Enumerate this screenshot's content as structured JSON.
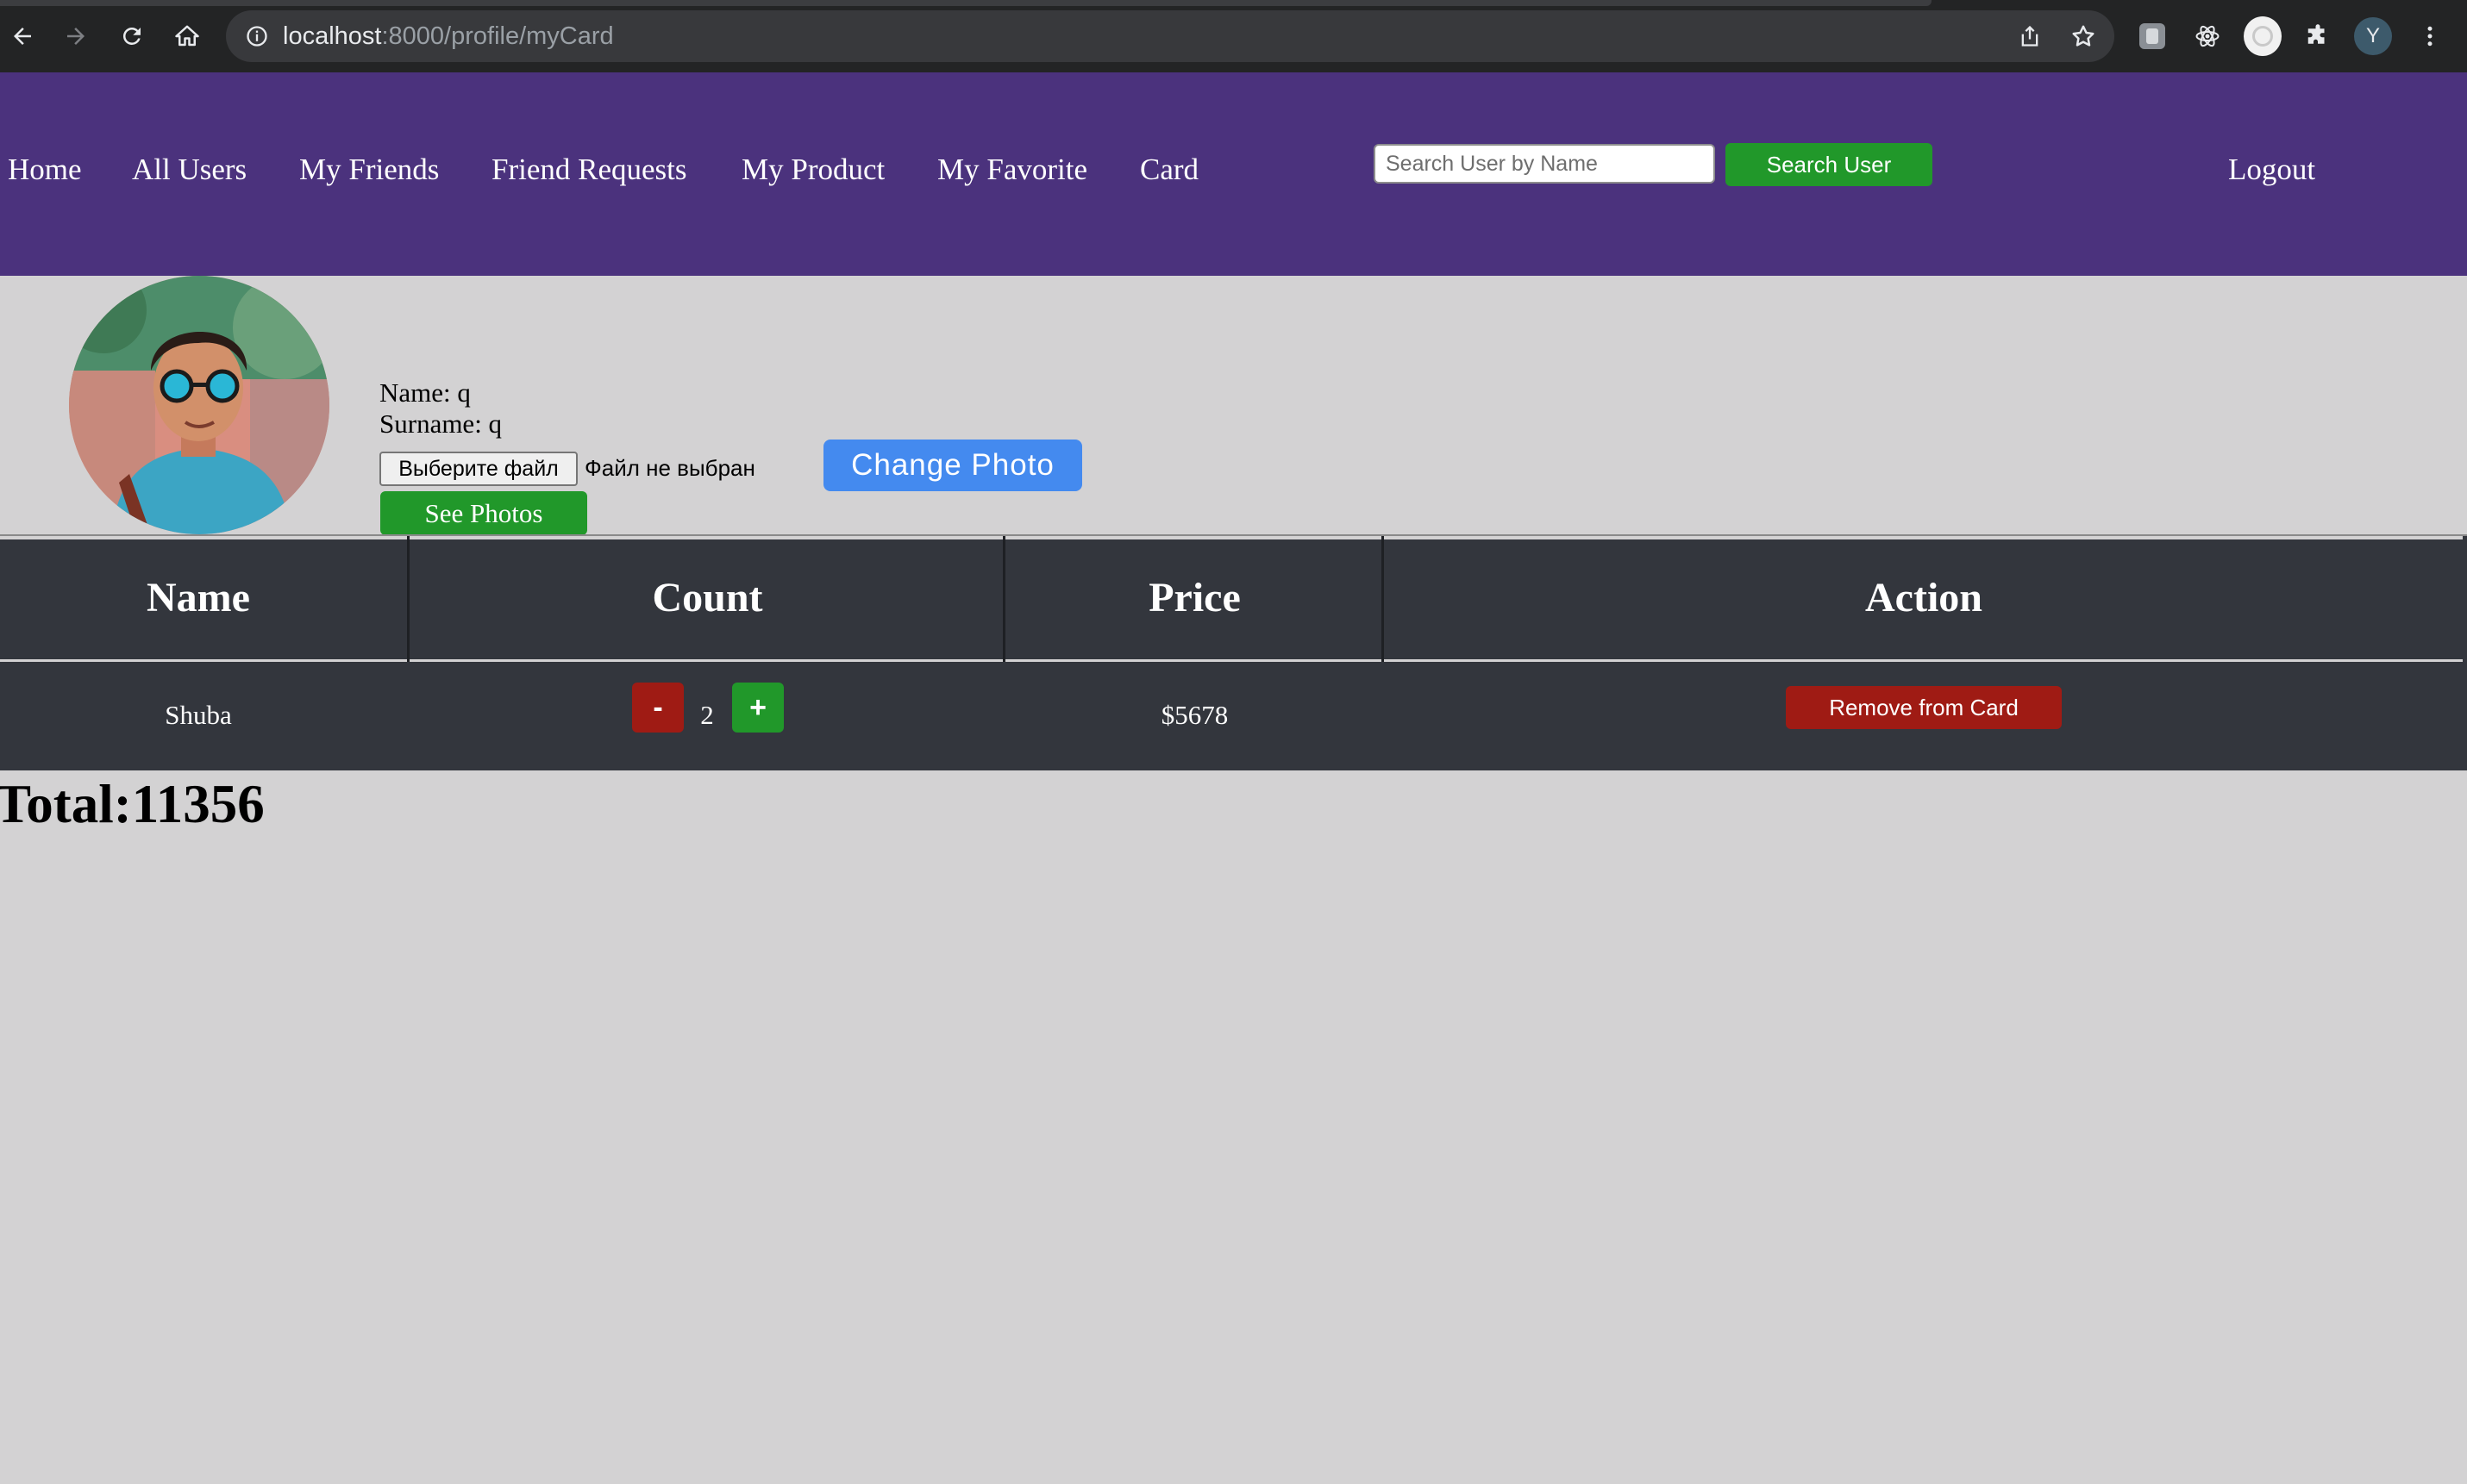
{
  "browser": {
    "url_host": "localhost",
    "url_path": ":8000/profile/myCard",
    "profile_initial": "Y"
  },
  "navbar": {
    "links": [
      "Home",
      "All Users",
      "My Friends",
      "Friend Requests",
      "My Product",
      "My Favorite",
      "Card"
    ],
    "search_placeholder": "Search User by Name",
    "search_button": "Search User",
    "logout": "Logout",
    "background_color": "#4b327d"
  },
  "profile": {
    "name_line": "Name: q",
    "surname_line": "Surname: q",
    "file_button": "Выберите файл",
    "file_status": "Файл не выбран",
    "change_photo": "Change Photo",
    "see_photos": "See Photos"
  },
  "table": {
    "headers": [
      "Name",
      "Count",
      "Price",
      "Action"
    ],
    "rows": [
      {
        "name": "Shuba",
        "minus": "-",
        "count": "2",
        "plus": "+",
        "price": "$5678",
        "action": "Remove from Card"
      }
    ]
  },
  "total": "Total:11356",
  "colors": {
    "accent_green": "#21982a",
    "danger_red": "#9f1b14",
    "primary_blue": "#448aef",
    "table_bg": "#33363d",
    "page_bg": "#d3d2d3"
  },
  "icons": [
    "back-icon",
    "forward-icon",
    "reload-icon",
    "home-icon",
    "info-icon",
    "share-icon",
    "star-icon",
    "extension-icon",
    "react-icon",
    "puzzle-icon",
    "menu-icon"
  ]
}
